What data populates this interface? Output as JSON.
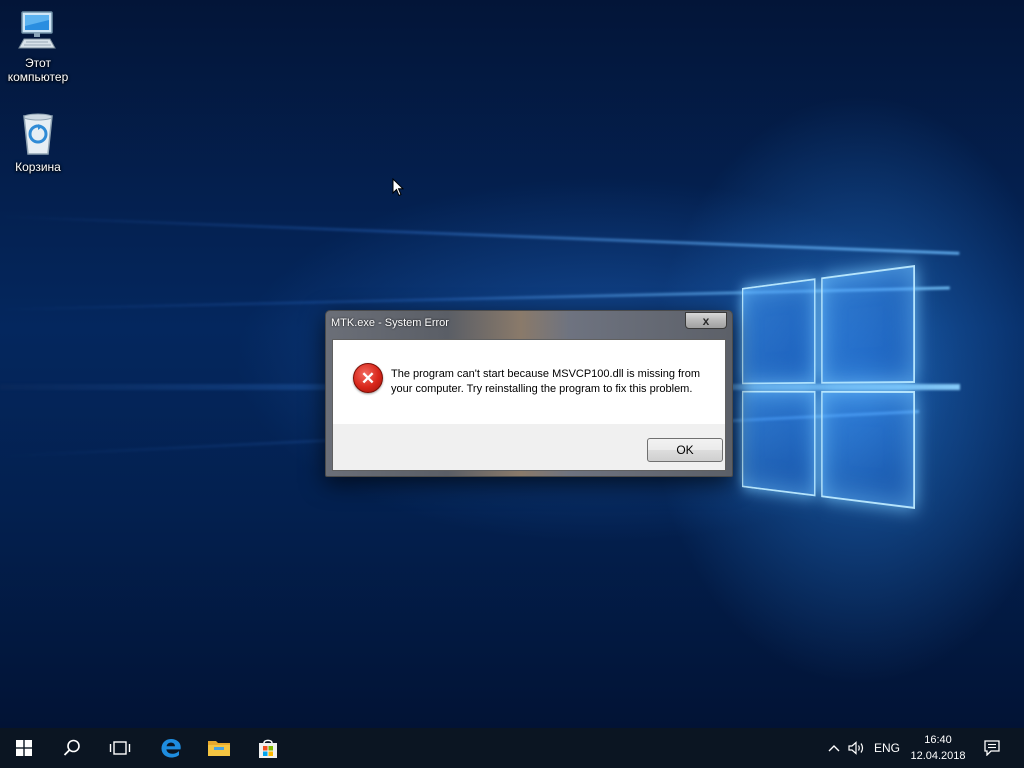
{
  "desktop": {
    "icons": [
      {
        "label": "Этот компьютер",
        "icon": "this-pc-icon"
      },
      {
        "label": "Корзина",
        "icon": "recycle-bin-icon"
      }
    ]
  },
  "dialog": {
    "title": "MTK.exe - System Error",
    "close_label": "x",
    "icon": "error-icon",
    "message": "The program can't start because MSVCP100.dll is missing from your computer. Try reinstalling the program to fix this problem.",
    "ok_label": "OK"
  },
  "taskbar": {
    "buttons": [
      "start-icon",
      "search-icon",
      "task-view-icon",
      "edge-icon",
      "file-explorer-icon",
      "store-icon"
    ],
    "tray": {
      "language": "ENG",
      "time": "16:40",
      "date": "12.04.2018"
    }
  },
  "colors": {
    "taskbar": "#0b1522",
    "error_red": "#d8261a",
    "edge_blue": "#1e8de0",
    "explorer_yellow": "#f5c542"
  }
}
